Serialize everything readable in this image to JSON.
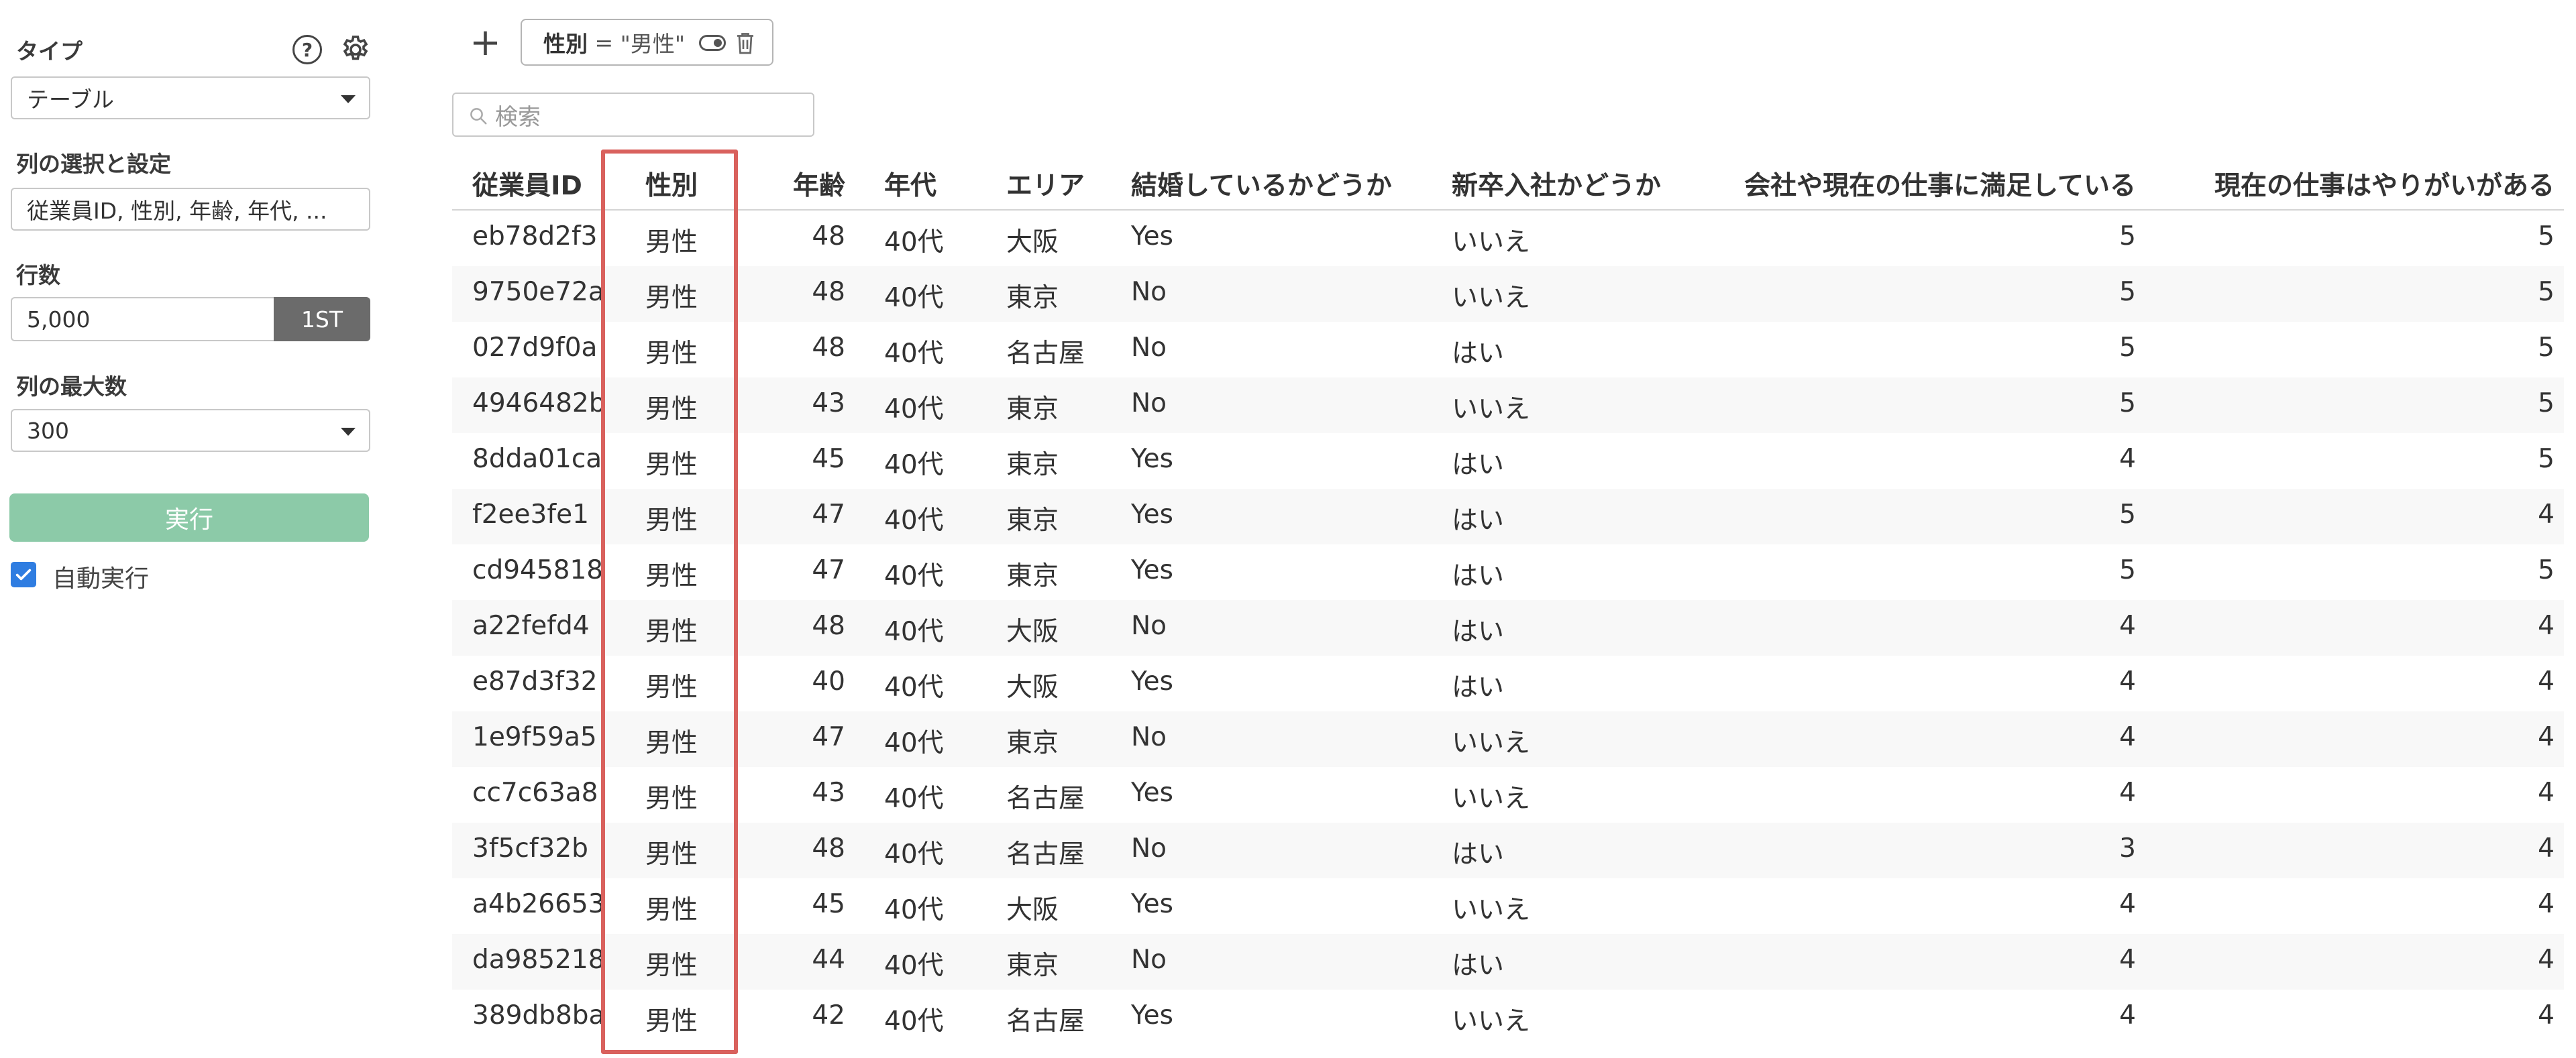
{
  "sidebar": {
    "type_label": "タイプ",
    "type_value": "テーブル",
    "columns_label": "列の選択と設定",
    "columns_value": "従業員ID, 性別, 年齢, 年代, ...",
    "rows_label": "行数",
    "rows_value": "5,000",
    "rows_button": "1ST",
    "max_cols_label": "列の最大数",
    "max_cols_value": "300",
    "run_button": "実行",
    "auto_run_label": "自動実行",
    "auto_run_checked": true
  },
  "filter": {
    "key": "性別",
    "operator": " = ",
    "value": "\"男性\""
  },
  "search": {
    "placeholder": "検索"
  },
  "table": {
    "headers": [
      "従業員ID",
      "性別",
      "年齢",
      "年代",
      "エリア",
      "結婚しているかどうか",
      "新卒入社かどうか",
      "会社や現在の仕事に満足している",
      "現在の仕事はやりがいがある"
    ],
    "rows": [
      [
        "eb78d2f3",
        "男性",
        "48",
        "40代",
        "大阪",
        "Yes",
        "いいえ",
        "5",
        "5"
      ],
      [
        "9750e72a",
        "男性",
        "48",
        "40代",
        "東京",
        "No",
        "いいえ",
        "5",
        "5"
      ],
      [
        "027d9f0a",
        "男性",
        "48",
        "40代",
        "名古屋",
        "No",
        "はい",
        "5",
        "5"
      ],
      [
        "4946482b",
        "男性",
        "43",
        "40代",
        "東京",
        "No",
        "いいえ",
        "5",
        "5"
      ],
      [
        "8dda01ca",
        "男性",
        "45",
        "40代",
        "東京",
        "Yes",
        "はい",
        "4",
        "5"
      ],
      [
        "f2ee3fe1",
        "男性",
        "47",
        "40代",
        "東京",
        "Yes",
        "はい",
        "5",
        "4"
      ],
      [
        "cd945818",
        "男性",
        "47",
        "40代",
        "東京",
        "Yes",
        "はい",
        "5",
        "5"
      ],
      [
        "a22fefd4",
        "男性",
        "48",
        "40代",
        "大阪",
        "No",
        "はい",
        "4",
        "4"
      ],
      [
        "e87d3f32",
        "男性",
        "40",
        "40代",
        "大阪",
        "Yes",
        "はい",
        "4",
        "4"
      ],
      [
        "1e9f59a5",
        "男性",
        "47",
        "40代",
        "東京",
        "No",
        "いいえ",
        "4",
        "4"
      ],
      [
        "cc7c63a8",
        "男性",
        "43",
        "40代",
        "名古屋",
        "Yes",
        "いいえ",
        "4",
        "4"
      ],
      [
        "3f5cf32b",
        "男性",
        "48",
        "40代",
        "名古屋",
        "No",
        "はい",
        "3",
        "4"
      ],
      [
        "a4b26653",
        "男性",
        "45",
        "40代",
        "大阪",
        "Yes",
        "いいえ",
        "4",
        "4"
      ],
      [
        "da985218",
        "男性",
        "44",
        "40代",
        "東京",
        "No",
        "はい",
        "4",
        "4"
      ],
      [
        "389db8ba",
        "男性",
        "42",
        "40代",
        "名古屋",
        "Yes",
        "いいえ",
        "4",
        "4"
      ]
    ]
  },
  "colors": {
    "run_button": "#8ccaa8",
    "highlight_border": "#d9615d",
    "checkbox": "#2f7de1"
  }
}
